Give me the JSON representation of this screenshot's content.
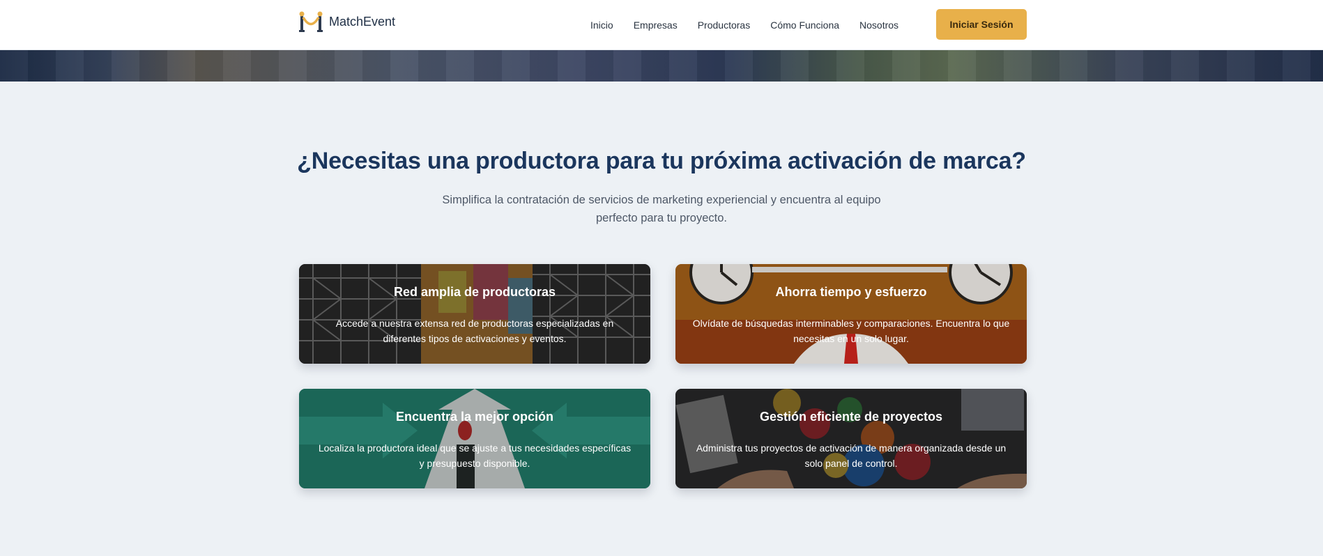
{
  "header": {
    "brand": "MatchEvent",
    "nav": [
      {
        "label": "Inicio"
      },
      {
        "label": "Empresas"
      },
      {
        "label": "Productoras"
      },
      {
        "label": "Cómo Funciona"
      },
      {
        "label": "Nosotros"
      }
    ],
    "login_label": "Iniciar Sesión"
  },
  "section": {
    "title": "¿Necesitas una productora para tu próxima activación de marca?",
    "subtitle": "Simplifica la contratación de servicios de marketing experiencial y encuentra al equipo perfecto para tu proyecto."
  },
  "cards": [
    {
      "title": "Red amplia de productoras",
      "description": "Accede a nuestra extensa red de productoras especializadas en diferentes tipos de activaciones y eventos."
    },
    {
      "title": "Ahorra tiempo y esfuerzo",
      "description": "Olvídate de búsquedas interminables y comparaciones. Encuentra lo que necesitas en un solo lugar."
    },
    {
      "title": "Encuentra la mejor opción",
      "description": "Localiza la productora ideal que se ajuste a tus necesidades específicas y presupuesto disponible."
    },
    {
      "title": "Gestión eficiente de proyectos",
      "description": "Administra tus proyectos de activación de manera organizada desde un solo panel de control."
    }
  ],
  "colors": {
    "accent": "#e8b04a",
    "heading": "#1b365d",
    "background": "#edf1f5"
  }
}
